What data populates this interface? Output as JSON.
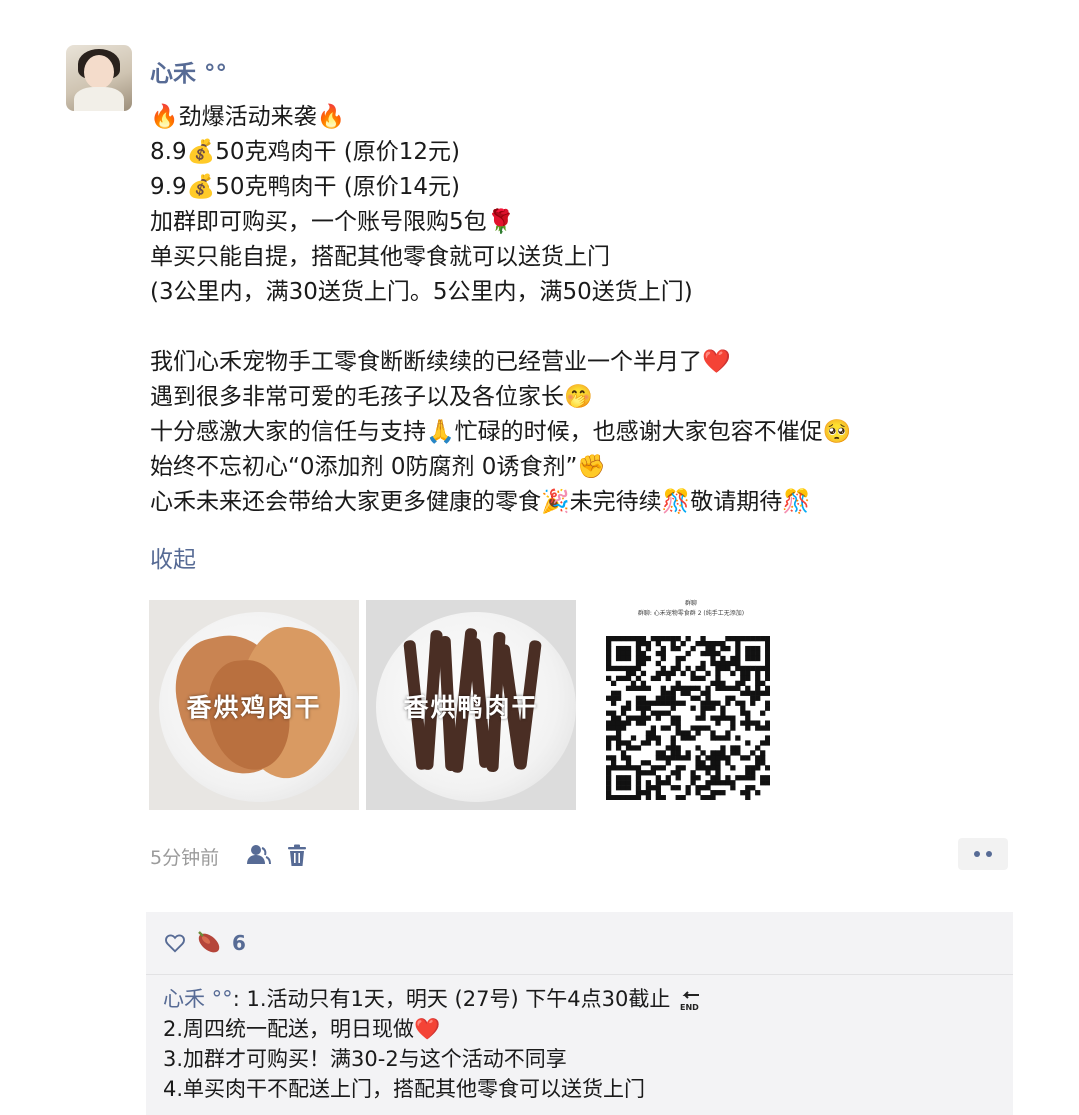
{
  "post": {
    "author": "心禾 °°",
    "lines": [
      "🔥劲爆活动来袭🔥",
      "8.9💰50克鸡肉干 (原价12元)",
      "9.9💰50克鸭肉干 (原价14元)",
      "加群即可购买，一个账号限购5包🌹",
      "单买只能自提，搭配其他零食就可以送货上门",
      "(3公里内，满30送货上门。5公里内，满50送货上门)",
      "",
      "我们心禾宠物手工零食断断续续的已经营业一个半月了❤️",
      "遇到很多非常可爱的毛孩子以及各位家长🤭",
      "十分感激大家的信任与支持🙏忙碌的时候，也感谢大家包容不催促🥺",
      "始终不忘初心“0添加剂 0防腐剂 0诱食剂”✊",
      "心禾未来还会带给大家更多健康的零食🎉未完待续🎊敬请期待🎊"
    ],
    "collapse_label": "收起",
    "photos": [
      {
        "label": "香烘鸡肉干"
      },
      {
        "label": "香烘鸭肉干"
      }
    ],
    "qr": {
      "header": "群聊",
      "caption": "群聊: 心禾宠物零食群 2 (纯手工无添加)"
    },
    "timestamp": "5分钟前",
    "icons": {
      "privacy": "person-privacy-icon",
      "delete": "trash-icon",
      "more": "more-dots-icon",
      "like": "heart-outline-icon",
      "like_avatar": "sweet-potato-icon",
      "end": "end-arrow-icon"
    },
    "colors": {
      "link": "#576b95",
      "comment_bg": "#f3f3f5",
      "meta": "#9b9b9b"
    }
  },
  "likes": {
    "count": "6"
  },
  "comment": {
    "author": "心禾 °°",
    "separator": ": ",
    "lines": [
      "1.活动只有1天，明天 (27号) 下午4点30截止",
      "2.周四统一配送，明日现做❤️",
      "3.加群才可购买！满30-2与这个活动不同享",
      "4.单买肉干不配送上门，搭配其他零食可以送货上门"
    ]
  }
}
